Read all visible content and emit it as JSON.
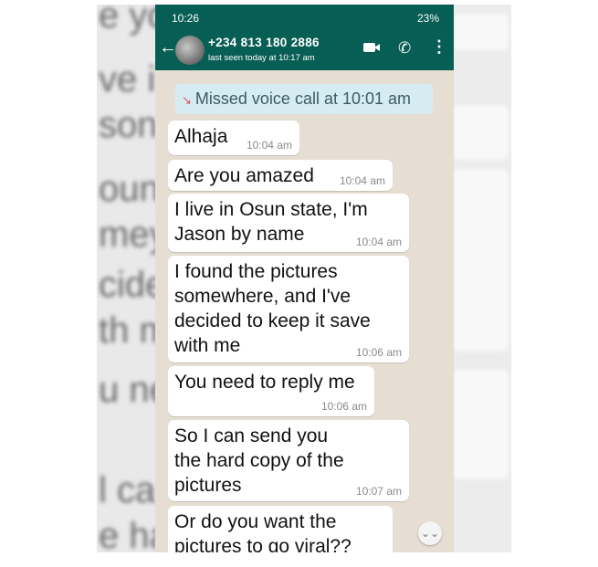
{
  "status_bar": {
    "time": "10:26",
    "right": "23%"
  },
  "header": {
    "contact_name": "+234 813 180 2886",
    "last_seen": "last seen today at 10:17 am"
  },
  "system_message": {
    "text": "Missed voice call at 10:01 am"
  },
  "messages": [
    {
      "text": "Alhaja",
      "time": "10:04 am"
    },
    {
      "text": "Are you amazed",
      "time": "10:04 am"
    },
    {
      "text": "I live in Osun state, I'm\nJason by name",
      "time": "10:04 am"
    },
    {
      "text": "I found the pictures\nsomewhere, and I've\ndecided to keep it save\nwith me",
      "time": "10:06 am"
    },
    {
      "text": "You need to reply me",
      "time": "10:06 am"
    },
    {
      "text": "So I can send you\nthe hard copy of the\npictures",
      "time": "10:07 am"
    },
    {
      "text": "Or do you want the\npictures to go viral??",
      "time": ""
    }
  ],
  "icons": {
    "back": "arrow-left",
    "video": "video-camera",
    "call": "phone",
    "menu": "vertical-dots",
    "scroll": "chevron-double-down"
  },
  "colors": {
    "header": "#075e54",
    "chat_background": "#e6ddd3",
    "system_bubble": "#d5ecf3",
    "bubble": "#ffffff"
  }
}
